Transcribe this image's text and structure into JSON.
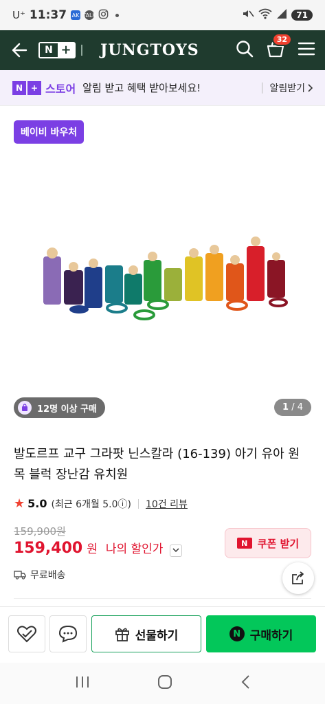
{
  "status_bar": {
    "carrier": "U⁺",
    "time": "11:37",
    "app_badges": [
      "AK",
      "TALK"
    ],
    "battery": "71"
  },
  "header": {
    "n_box": "N",
    "plus_box": "+",
    "brand": "JUNGTOYS",
    "cart_count": "32",
    "bg_color": "#1f3b2e"
  },
  "notice": {
    "logo_n": "N",
    "logo_plus": "+",
    "logo_word": "스토어",
    "message": "알림 받고 혜택 받아보세요!",
    "subscribe": "알림받기",
    "accent": "#7b3fe4"
  },
  "product_image": {
    "voucher_badge": "베이비 바우처",
    "buyers_chip": "12명 이상 구매",
    "page_current": "1",
    "page_sep": " / ",
    "page_total": "4"
  },
  "product": {
    "title": "발도르프 교구 그라팟 닌스칼라 (16-139) 아기 유아 원목 블럭 장난감 유치원",
    "rating": "5.0",
    "recent_rating": "(최근 6개월 5.0ⓘ)",
    "review_count": "10건 리뷰",
    "original_price": "159,900원",
    "sale_price": "159,400",
    "currency": "원",
    "my_discount": "나의 할인가",
    "coupon_logo": "N",
    "coupon_label": "쿠폰 받기",
    "shipping": "무료배송",
    "price_color": "#e0142f"
  },
  "actions": {
    "gift_label": "선물하기",
    "buy_logo": "N",
    "buy_label": "구매하기",
    "buy_color": "#03c75a"
  },
  "icons": {
    "back": "back-arrow-icon",
    "search": "search-icon",
    "cart": "cart-icon",
    "menu": "menu-icon",
    "wishlist": "heart-check-icon",
    "chat": "chat-bubble-icon",
    "share": "share-icon",
    "gift": "gift-icon",
    "truck": "truck-icon"
  }
}
